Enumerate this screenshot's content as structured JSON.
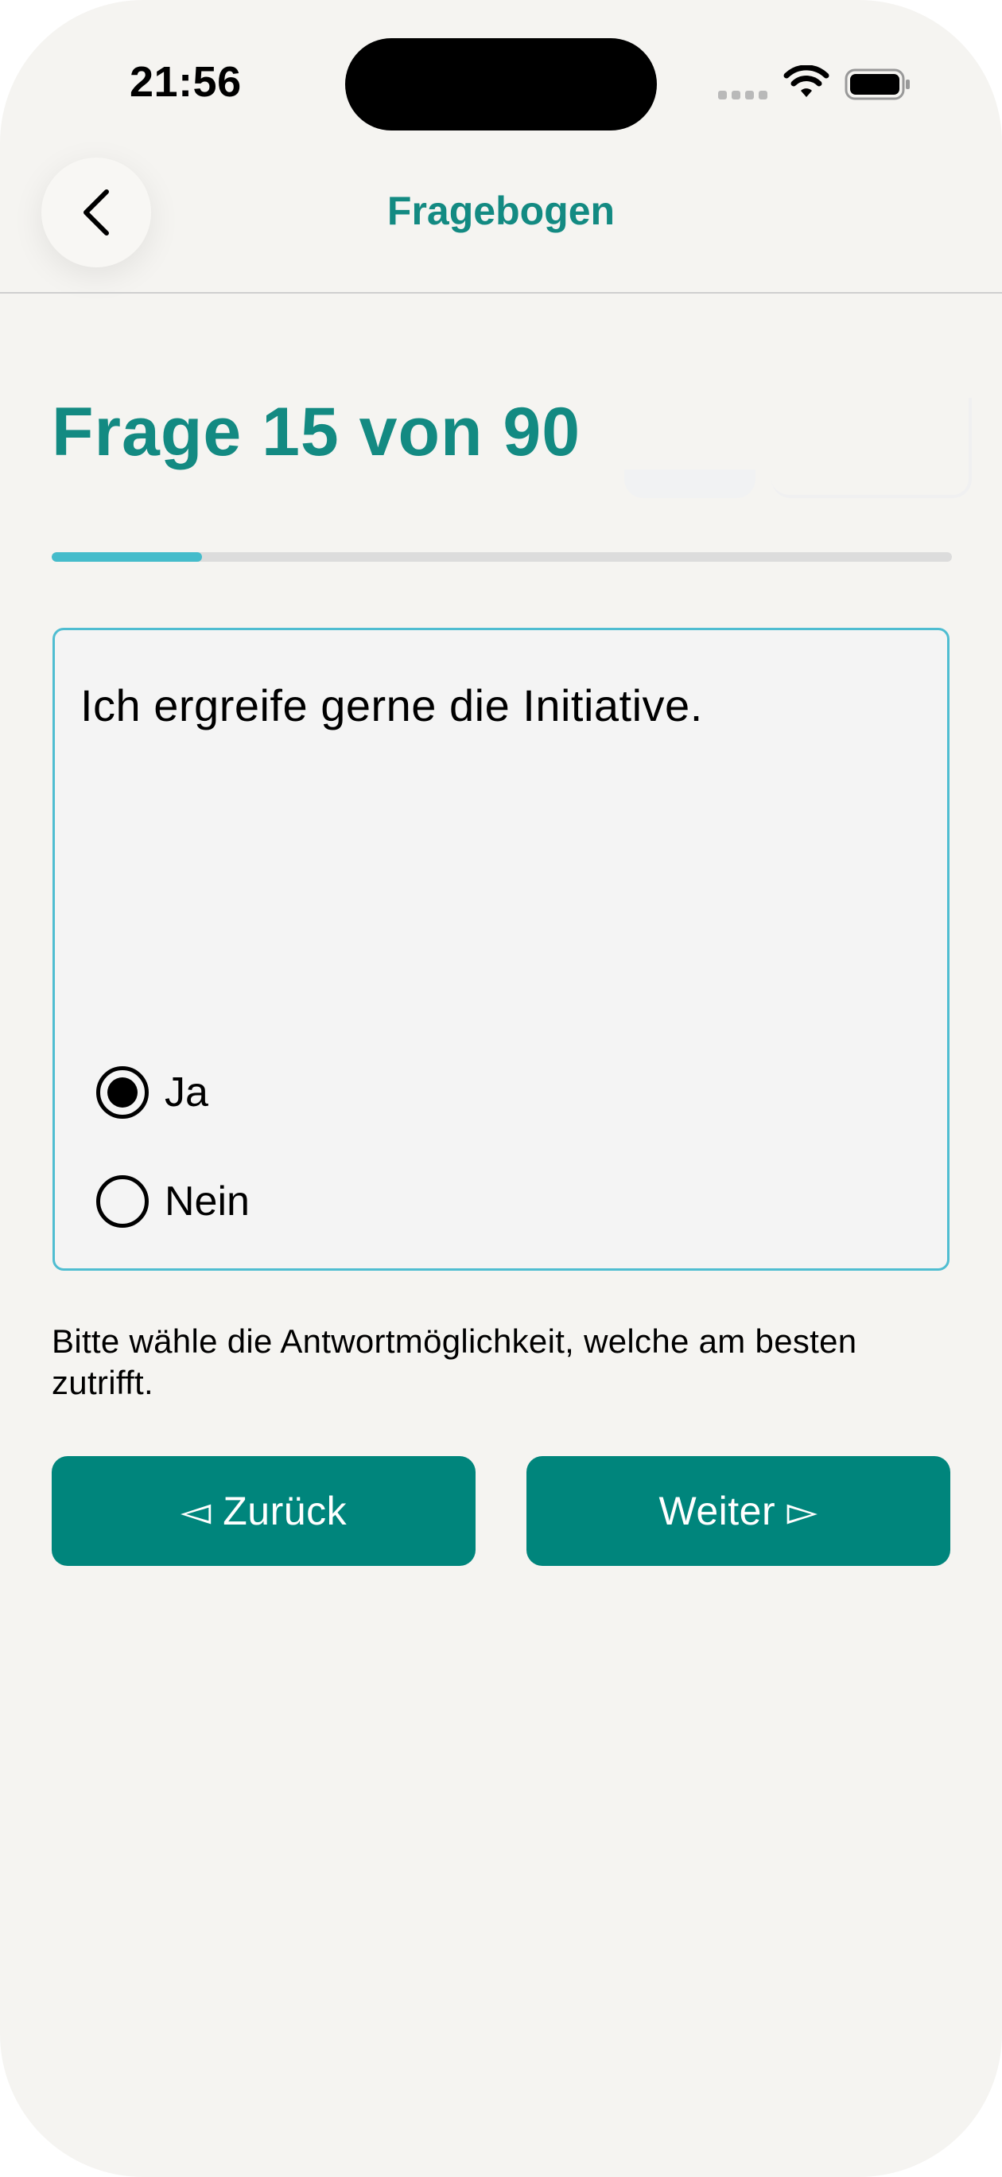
{
  "status_bar": {
    "time": "21:56"
  },
  "nav": {
    "title": "Fragebogen",
    "back_icon": "chevron-left-icon"
  },
  "question": {
    "title": "Frage 15 von 90",
    "current": 15,
    "total": 90,
    "progress_fraction": 0.1667,
    "text": "Ich ergreife gerne die Initiative."
  },
  "options": [
    {
      "label": "Ja",
      "selected": true
    },
    {
      "label": "Nein",
      "selected": false
    }
  ],
  "hint": "Bitte wähle die Antwortmöglichkeit, welche am besten zutrifft.",
  "buttons": {
    "back_label": "◅ Zurück",
    "next_label": "Weiter ▻"
  },
  "colors": {
    "accent": "#138a82",
    "button": "#00857c",
    "progress": "#45bccb",
    "card_border": "#4fbdd1",
    "background": "#f5f4f1"
  }
}
